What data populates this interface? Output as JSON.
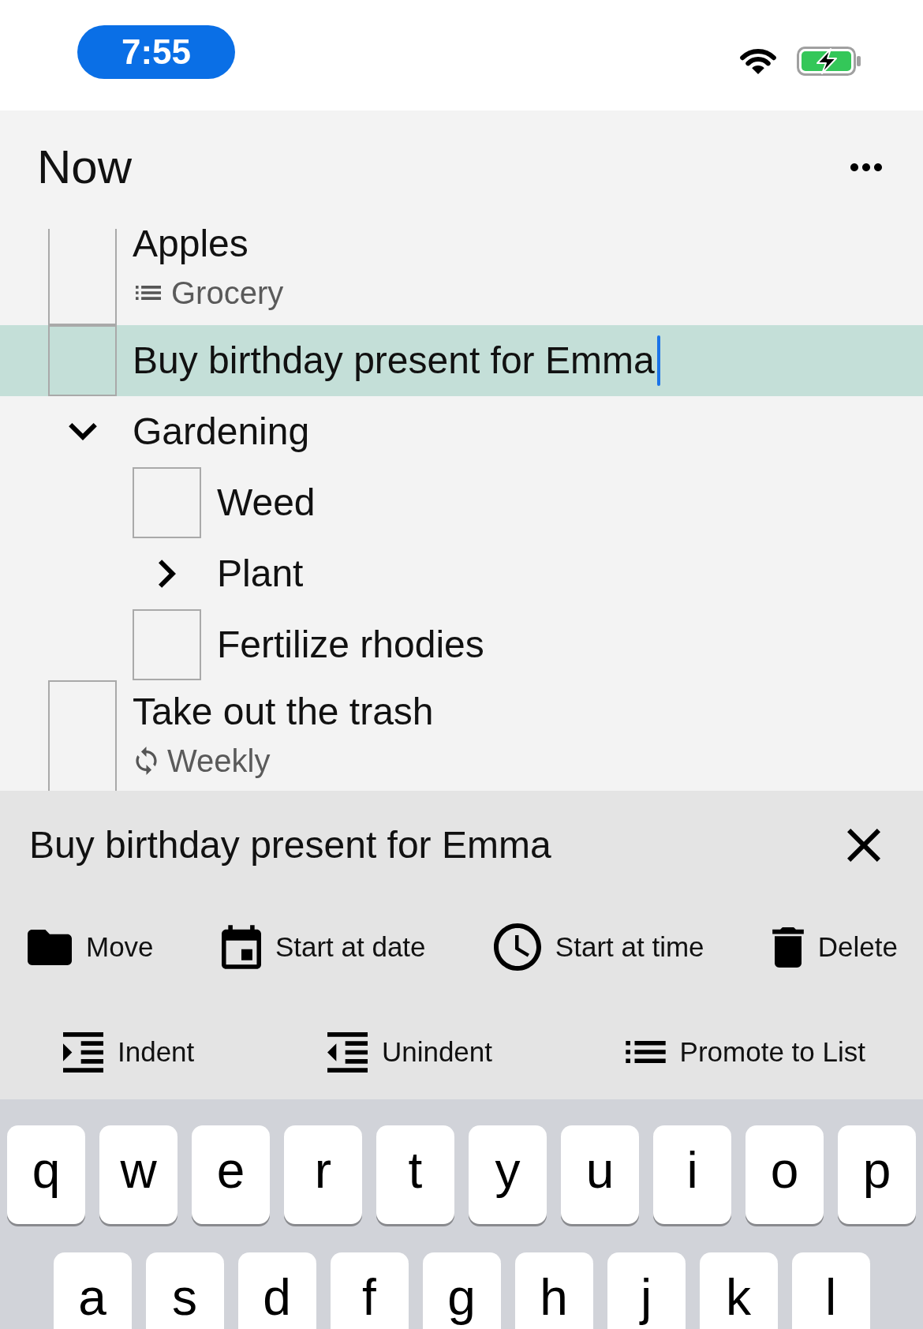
{
  "status_bar": {
    "time": "7:55"
  },
  "header": {
    "title": "Now"
  },
  "tasks": [
    {
      "kind": "task",
      "title": "Apples",
      "checked": false,
      "selected": false,
      "subtitle": {
        "kind": "list",
        "text": "Grocery"
      }
    },
    {
      "kind": "task",
      "title": "Buy birthday present for Emma",
      "checked": false,
      "selected": true
    },
    {
      "kind": "group",
      "title": "Gardening",
      "expanded": true,
      "selected": false,
      "children": [
        {
          "kind": "task",
          "title": "Weed",
          "checked": false,
          "selected": false
        },
        {
          "kind": "group",
          "title": "Plant",
          "expanded": false,
          "selected": false
        },
        {
          "kind": "task",
          "title": "Fertilize rhodies",
          "checked": false,
          "selected": false
        }
      ]
    },
    {
      "kind": "task",
      "title": "Take out the trash",
      "checked": false,
      "selected": false,
      "subtitle": {
        "kind": "repeat",
        "text": "Weekly"
      }
    }
  ],
  "editor": {
    "title": "Buy birthday present for Emma",
    "action_rows": [
      [
        {
          "kind": "move",
          "label": "Move"
        },
        {
          "kind": "date",
          "label": "Start at date"
        },
        {
          "kind": "time",
          "label": "Start at time"
        },
        {
          "kind": "delete",
          "label": "Delete"
        }
      ],
      [
        {
          "kind": "indent",
          "label": "Indent"
        },
        {
          "kind": "unindent",
          "label": "Unindent"
        },
        {
          "kind": "promote",
          "label": "Promote to List"
        }
      ]
    ]
  },
  "keyboard": {
    "rows": [
      [
        "q",
        "w",
        "e",
        "r",
        "t",
        "y",
        "u",
        "i",
        "o",
        "p"
      ],
      [
        "a",
        "s",
        "d",
        "f",
        "g",
        "h",
        "j",
        "k",
        "l"
      ]
    ]
  }
}
